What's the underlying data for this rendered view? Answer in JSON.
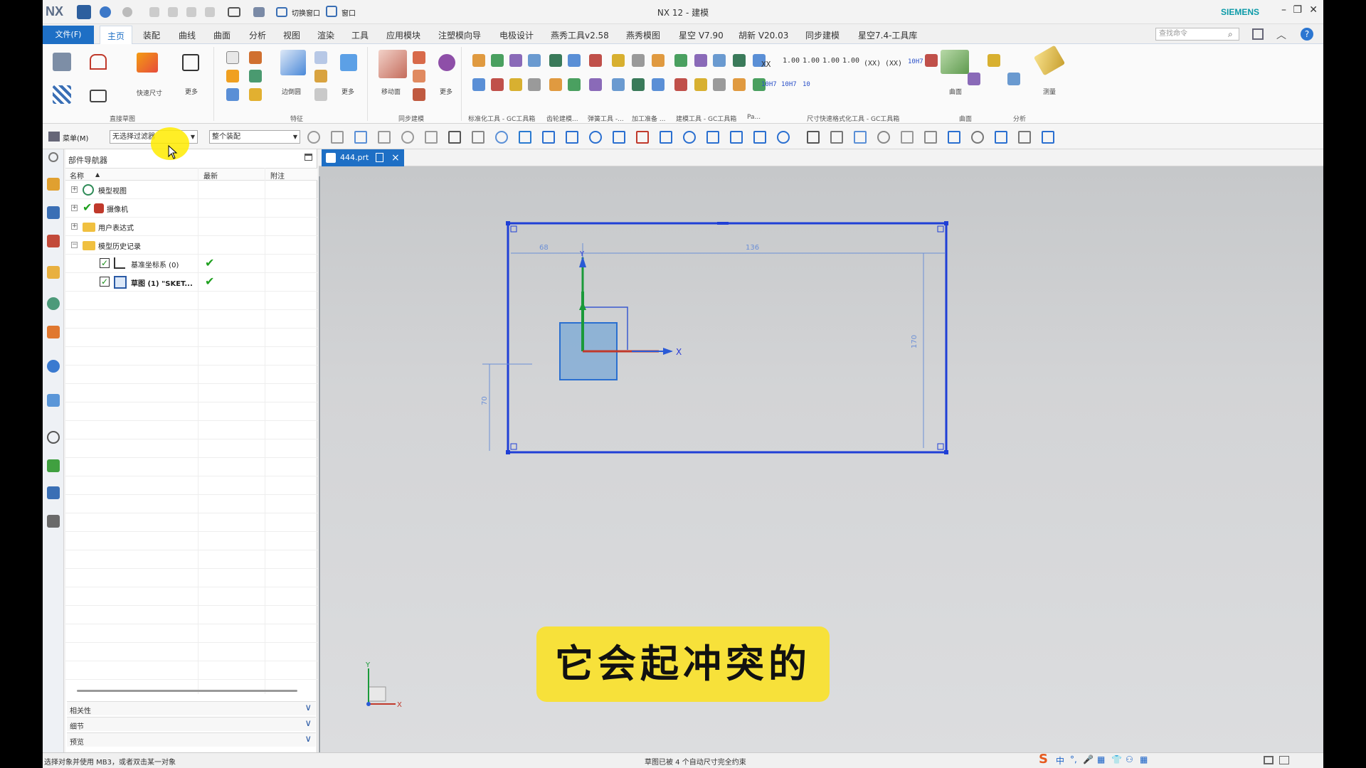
{
  "window": {
    "app_logo": "NX",
    "title": "NX 12 - 建模",
    "brand": "SIEMENS",
    "quick_access": [
      "切换窗口",
      "窗口"
    ]
  },
  "menu": {
    "file": "文件(F)",
    "tabs": [
      "主页",
      "装配",
      "曲线",
      "曲面",
      "分析",
      "视图",
      "渲染",
      "工具",
      "应用模块",
      "注塑模向导",
      "电极设计",
      "燕秀工具v2.58",
      "燕秀模图",
      "星空 V7.90",
      "胡新 V20.03",
      "同步建模",
      "星空7.4-工具库"
    ],
    "active_tab": "主页",
    "search_placeholder": "查找命令"
  },
  "ribbon": {
    "labels": {
      "quick_dim": "快速尺寸",
      "more1": "更多",
      "chamfer": "边倒圆",
      "more2": "更多",
      "move_face": "移动面",
      "more3": "更多",
      "surface": "曲面",
      "measure": "测量"
    },
    "groups": [
      "直接草图",
      "特征",
      "同步建模",
      "标准化工具 - GC工具箱",
      "齿轮建模...",
      "弹簧工具 -...",
      "加工准备 ...",
      "建模工具 - GC工具箱",
      "Pa...",
      "尺寸快速格式化工具 - GC工具箱",
      "曲面",
      "分析"
    ],
    "dim_texts": [
      "XX",
      "1.00",
      "1.00",
      "1.00",
      "1.00",
      "(XX)",
      "(XX)",
      "10H7",
      "10H7",
      "10H7",
      "10"
    ]
  },
  "toolbar": {
    "menu_label": "菜单(M)",
    "filter_value": "无选择过滤器",
    "assembly_value": "整个装配"
  },
  "navigator": {
    "title": "部件导航器",
    "columns": [
      "名称",
      "最新",
      "附注"
    ],
    "nodes": [
      {
        "label": "模型视图",
        "expander": "+"
      },
      {
        "label": "摄像机",
        "expander": "+"
      },
      {
        "label": "用户表达式",
        "expander": "+"
      },
      {
        "label": "模型历史记录",
        "expander": "−"
      },
      {
        "label": "基准坐标系 (0)",
        "checked": "✓",
        "latest": "✔"
      },
      {
        "label": "草图 (1) \"SKET...",
        "checked": "✓",
        "latest": "✔"
      }
    ],
    "panels": [
      "相关性",
      "细节",
      "预览"
    ]
  },
  "document": {
    "tab_name": "444.prt"
  },
  "sketch": {
    "dim_left": "68",
    "dim_top": "136",
    "dim_right": "170",
    "dim_vertical": "70",
    "axis_x": "X",
    "axis_y": "Y",
    "triad_x": "X",
    "triad_y": "Y"
  },
  "subtitle": "它会起冲突的",
  "status": {
    "left": "选择对象并使用 MB3，或者双击某一对象",
    "center": "草图已被 4 个自动尺寸完全约束"
  },
  "ime": [
    "S",
    "中",
    "°,",
    "🎤",
    "▦",
    "👕",
    "⚇",
    "▦"
  ],
  "colors": {
    "accent": "#1e6fc5",
    "sketch_line": "#1f3fd6",
    "subtitle_bg": "#f7e13a",
    "check_green": "#1fa01f"
  }
}
